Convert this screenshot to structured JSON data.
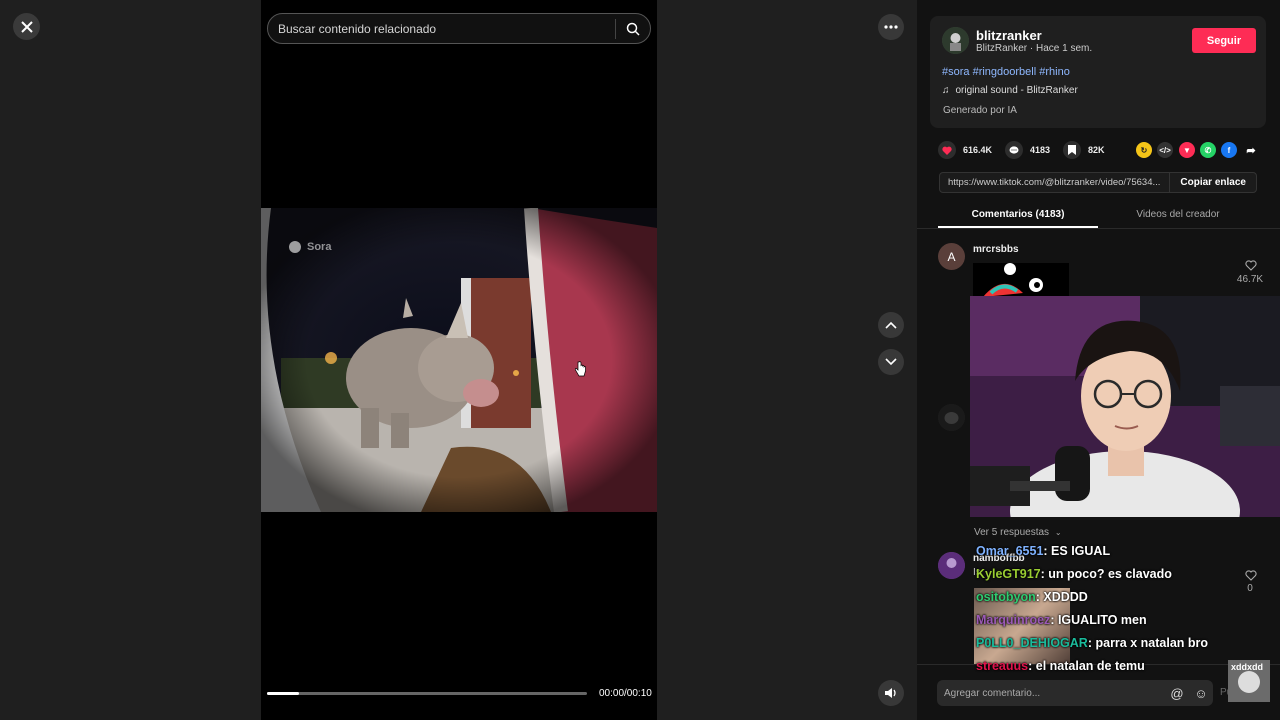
{
  "search": {
    "placeholder": "Buscar contenido relacionado"
  },
  "video": {
    "watermark": "Sora",
    "time": "00:00/00:10",
    "progress": 0.1
  },
  "author": {
    "name": "blitzranker",
    "subtitle": "BlitzRanker · Hace 1 sem.",
    "follow_label": "Seguir"
  },
  "post": {
    "tags": "#sora #ringdoorbell #rhino",
    "music": "original sound - BlitzRanker",
    "ai_label": "Generado por IA"
  },
  "stats": {
    "likes": "616.4K",
    "comments": "4183",
    "saves": "82K"
  },
  "link": {
    "url": "https://www.tiktok.com/@blitzranker/video/75634...",
    "copy_label": "Copiar enlace"
  },
  "tabs": [
    {
      "label": "Comentarios (4183)"
    },
    {
      "label": "Videos del creador"
    }
  ],
  "comments": [
    {
      "avatar": "A",
      "user": "mrcrsbbs",
      "likes": "46.7K"
    },
    {
      "user": "namboffbb",
      "text": "Is",
      "likes": "0"
    }
  ],
  "replies_label": "Ver 5 respuestas",
  "chat": [
    {
      "user": "Omar_6551",
      "msg": ": ES IGUAL",
      "color": "#7fb2ff"
    },
    {
      "user": "KyleGT917",
      "msg": ": un poco? es clavado",
      "color": "#9acd32"
    },
    {
      "user": "ositobyon",
      "msg": ": XDDDD",
      "color": "#2ecc71"
    },
    {
      "user": "Marquinroez",
      "msg": ": IGUALITO men",
      "color": "#9b59b6"
    },
    {
      "user": "P0LL0_DEHIOGAR",
      "msg": ": parra x natalan bro",
      "color": "#1abc9c"
    },
    {
      "user": "streauus",
      "msg": ": el natalan de temu",
      "color": "#e0144c"
    }
  ],
  "comment_input": {
    "placeholder": "Agregar comentario...",
    "post_label": "Publicar"
  },
  "mini_tag": "xddxdd",
  "colors": {
    "accent": "#fe2c55",
    "tag": "#8fb8ff"
  }
}
